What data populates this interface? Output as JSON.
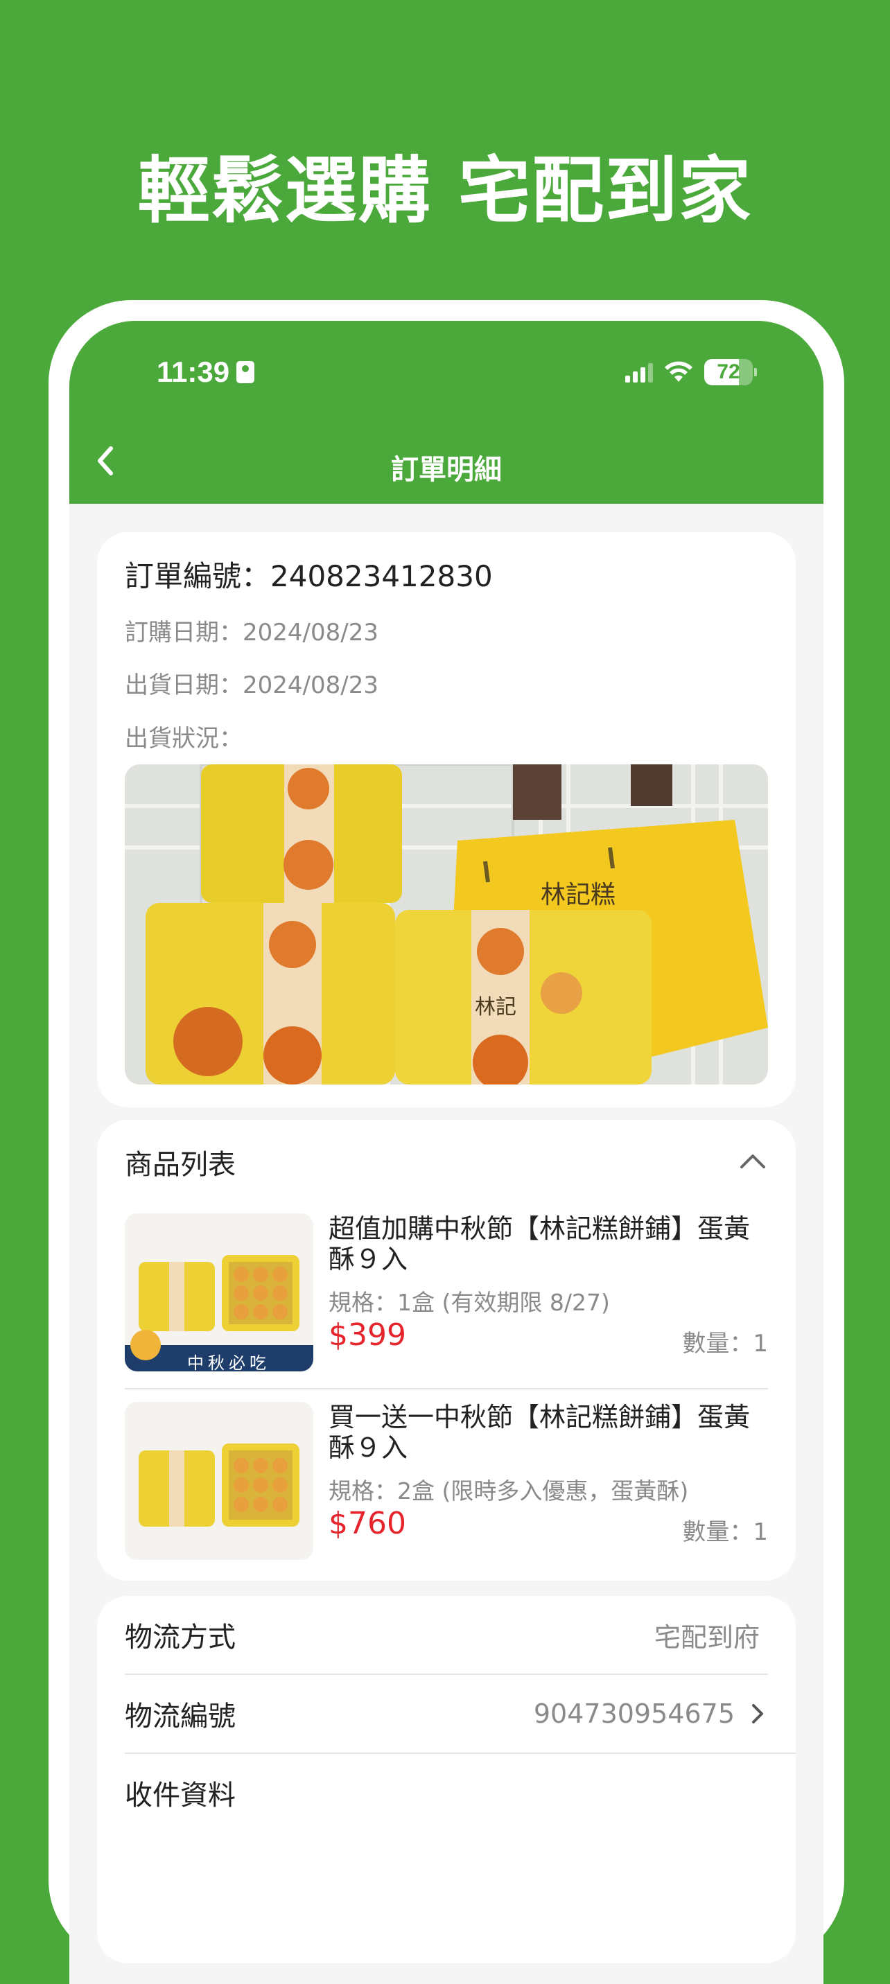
{
  "banner": {
    "headline": "輕鬆選購 宅配到家"
  },
  "colors": {
    "brand_green": "#4ba83a",
    "price_red": "#e5242b",
    "muted_gray": "#8a8a8a"
  },
  "status_bar": {
    "time": "11:39",
    "battery": "72",
    "icons": [
      "id-card-icon",
      "signal-icon",
      "wifi-icon",
      "battery-icon"
    ]
  },
  "app_bar": {
    "title": "訂單明細",
    "back_icon": "chevron-left-icon"
  },
  "order": {
    "number_label": "訂單編號：240823412830",
    "order_date": "訂購日期：2024/08/23",
    "ship_date": "出貨日期：2024/08/23",
    "ship_status": "出貨狀況："
  },
  "products": {
    "title": "商品列表",
    "toggle_icon": "chevron-up-icon",
    "items": [
      {
        "name": "超值加購中秋節【林記糕餅鋪】蛋黃酥９入",
        "spec": "規格：1盒 (有效期限 8/27)",
        "price": "$399",
        "qty": "數量：1",
        "thumb_caption": "中秋必吃"
      },
      {
        "name": "買一送一中秋節【林記糕餅鋪】蛋黃酥９入",
        "spec": "規格：2盒 (限時多入優惠，蛋黃酥)",
        "price": "$760",
        "qty": "數量：1"
      }
    ]
  },
  "shipping": {
    "method_label": "物流方式",
    "method_value": "宅配到府",
    "tracking_label": "物流編號",
    "tracking_value": "904730954675",
    "recipient_label": "收件資料"
  }
}
